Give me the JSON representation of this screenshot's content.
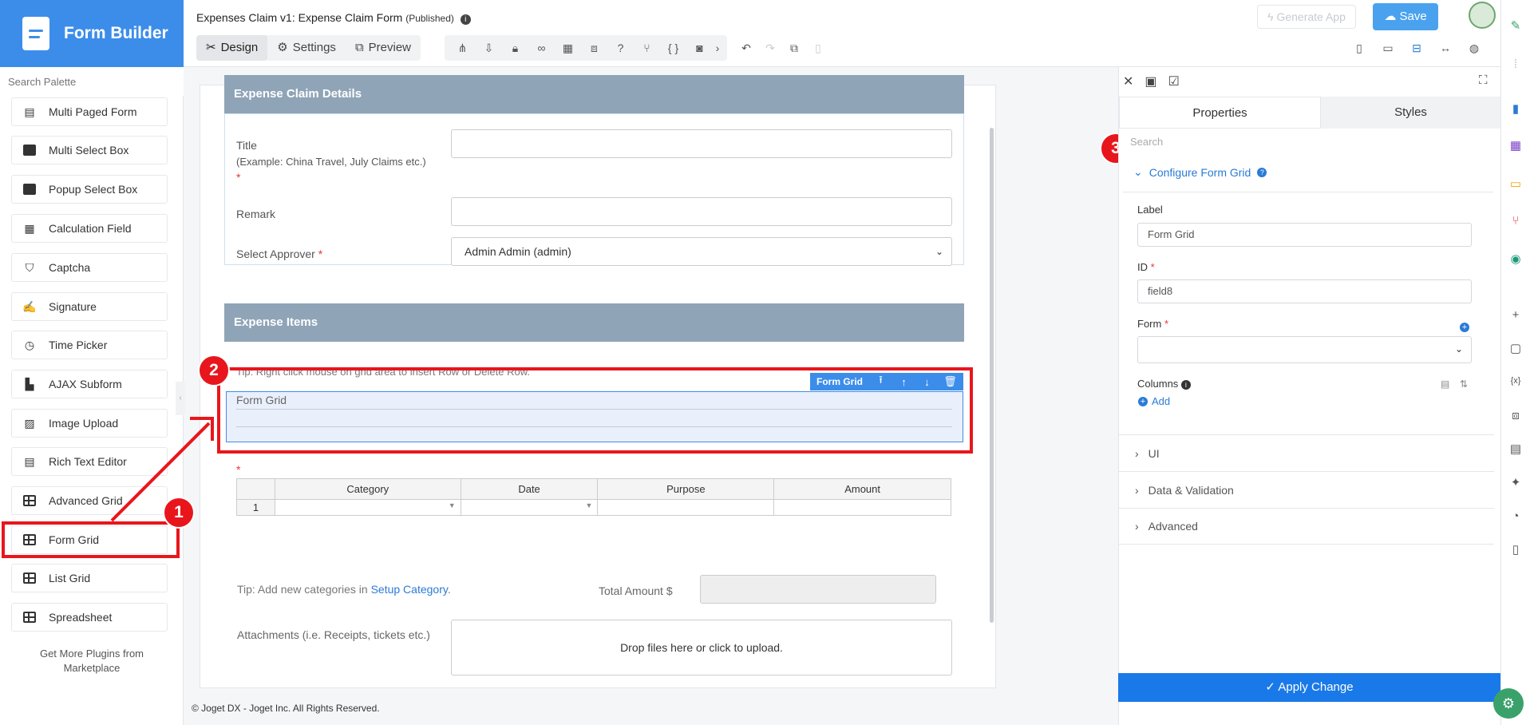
{
  "app": {
    "title": "Form Builder"
  },
  "header": {
    "form_title": "Expenses Claim v1: Expense Claim Form",
    "form_status": "(Published)",
    "tabs": [
      {
        "label": "Design"
      },
      {
        "label": "Settings"
      },
      {
        "label": "Preview"
      }
    ],
    "generate_app_label": "Generate App",
    "save_label": "Save"
  },
  "palette": {
    "search_placeholder": "Search Palette",
    "items": [
      {
        "label": "Multi Paged Form",
        "icon": "multi-page-icon"
      },
      {
        "label": "Multi Select Box",
        "icon": "select-box-icon"
      },
      {
        "label": "Popup Select Box",
        "icon": "select-box-icon"
      },
      {
        "label": "Calculation Field",
        "icon": "calculator-icon"
      },
      {
        "label": "Captcha",
        "icon": "shield-icon"
      },
      {
        "label": "Signature",
        "icon": "signature-icon"
      },
      {
        "label": "Time Picker",
        "icon": "clock-icon"
      },
      {
        "label": "AJAX Subform",
        "icon": "document-icon"
      },
      {
        "label": "Image Upload",
        "icon": "image-icon"
      },
      {
        "label": "Rich Text Editor",
        "icon": "rich-text-icon"
      },
      {
        "label": "Advanced Grid",
        "icon": "grid-icon"
      },
      {
        "label": "Form Grid",
        "icon": "grid-icon"
      },
      {
        "label": "List Grid",
        "icon": "grid-icon"
      },
      {
        "label": "Spreadsheet",
        "icon": "grid-icon"
      }
    ],
    "marketplace_text": "Get More Plugins from Marketplace"
  },
  "canvas": {
    "section1_title": "Expense Claim Details",
    "title_label": "Title",
    "title_hint": "(Example: China Travel, July Claims etc.)",
    "required_mark": "*",
    "remark_label": "Remark",
    "approver_label": "Select Approver",
    "approver_value": "Admin Admin (admin)",
    "section2_title": "Expense Items",
    "tip_grid": "Tip: Right click mouse on grid area to insert Row or Delete Row.",
    "form_grid_label": "Form Grid",
    "form_grid_toolbar_label": "Form Grid",
    "grid_columns": [
      "Category",
      "Date",
      "Purpose",
      "Amount"
    ],
    "grid_row_number": "1",
    "tip_category_prefix": "Tip: Add new categories in ",
    "tip_category_link": "Setup Category",
    "tip_category_suffix": ".",
    "total_label": "Total Amount $",
    "attachments_label": "Attachments (i.e. Receipts, tickets etc.)",
    "dropzone_text": "Drop files here or click to upload.",
    "footer": "© Joget DX - Joget Inc. All Rights Reserved."
  },
  "annotations": {
    "badge1": "1",
    "badge2": "2",
    "badge3": "3",
    "color": "#e8161c"
  },
  "properties": {
    "tabs": [
      "Properties",
      "Styles"
    ],
    "search_placeholder": "Search",
    "section_title": "Configure Form Grid",
    "label_label": "Label",
    "label_value": "Form Grid",
    "id_label": "ID",
    "id_value": "field8",
    "form_label": "Form",
    "columns_label": "Columns",
    "add_label": "Add",
    "accordions": [
      "UI",
      "Data & Validation",
      "Advanced"
    ],
    "apply_label": "Apply Change"
  },
  "colors": {
    "brand": "#3c8dea",
    "accent": "#1a79e8",
    "section": "#8fa4b7"
  }
}
